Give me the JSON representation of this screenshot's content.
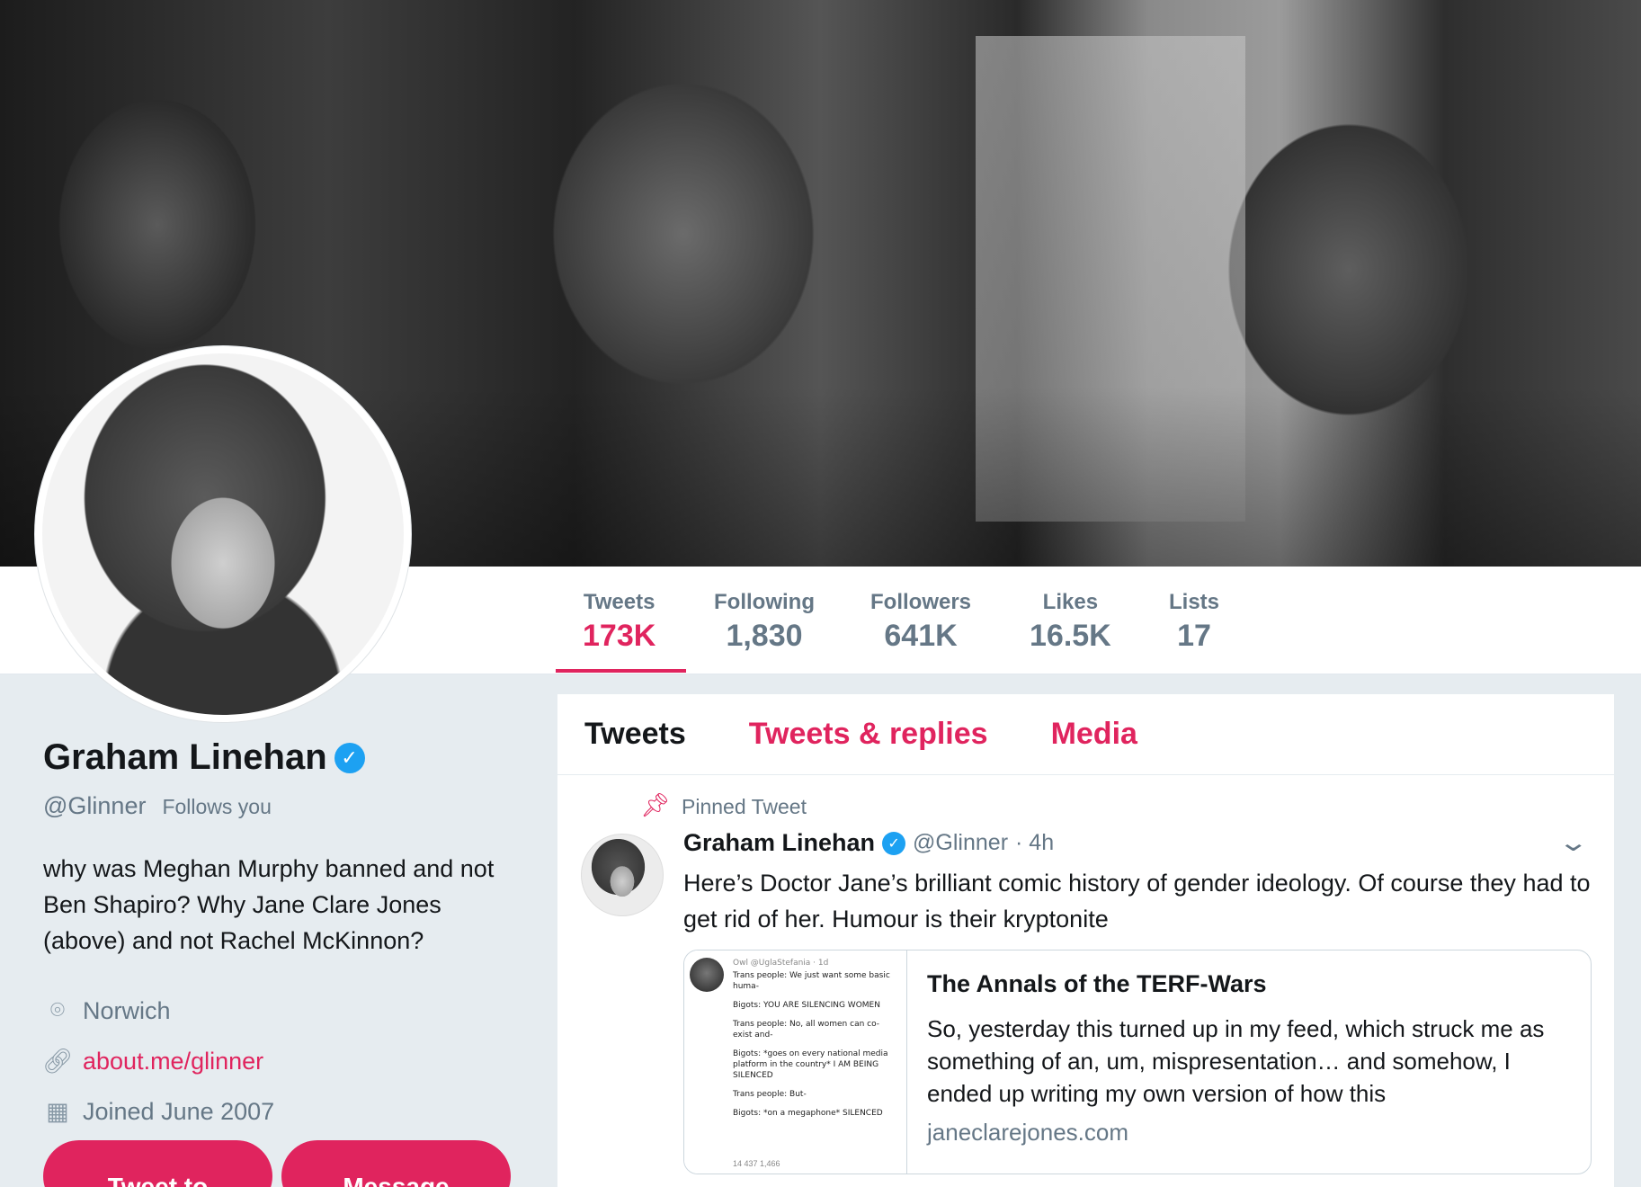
{
  "profile": {
    "name": "Graham Linehan",
    "handle": "@Glinner",
    "follows_you": "Follows you",
    "bio": "why was Meghan Murphy banned and not Ben Shapiro? Why Jane Clare Jones (above) and not Rachel McKinnon?",
    "location": "Norwich",
    "website": "about.me/glinner",
    "joined": "Joined June 2007",
    "buttons": {
      "tweet_to": "Tweet to",
      "message": "Message"
    }
  },
  "stats": [
    {
      "label": "Tweets",
      "value": "173K",
      "active": true
    },
    {
      "label": "Following",
      "value": "1,830"
    },
    {
      "label": "Followers",
      "value": "641K"
    },
    {
      "label": "Likes",
      "value": "16.5K"
    },
    {
      "label": "Lists",
      "value": "17"
    }
  ],
  "tabs": [
    {
      "label": "Tweets",
      "active": true
    },
    {
      "label": "Tweets & replies"
    },
    {
      "label": "Media"
    }
  ],
  "tweet": {
    "pinned_label": "Pinned Tweet",
    "author": "Graham Linehan",
    "handle": "@Glinner",
    "time": "· 4h",
    "text": "Here’s Doctor Jane’s brilliant comic history of gender ideology. Of course they had to get rid of her. Humour is their kryptonite",
    "card": {
      "title": "The Annals of the TERF-Wars",
      "description": "So, yesterday this turned up in my feed, which struck me as something of an, um, mispresentation… and somehow, I ended up writing my own version of how this",
      "domain": "janeclarejones.com",
      "thumb": {
        "head": "Owl @UglaStefania · 1d",
        "lines": [
          "Trans people: We just want some basic huma-",
          "Bigots: YOU ARE SILENCING WOMEN",
          "Trans people: No, all women can co-exist and-",
          "Bigots: *goes on every national media platform in the country* I AM BEING SILENCED",
          "Trans people: But-",
          "Bigots: *on a megaphone* SILENCED"
        ],
        "actions": "14   437   1,466"
      }
    }
  },
  "colors": {
    "accent": "#e0245e",
    "verified": "#1da1f2",
    "muted": "#657786",
    "bg": "#e6ecf0"
  },
  "icons": [
    "verified-badge-icon",
    "location-pin-icon",
    "link-icon",
    "calendar-icon",
    "pin-icon",
    "chevron-down-icon"
  ]
}
